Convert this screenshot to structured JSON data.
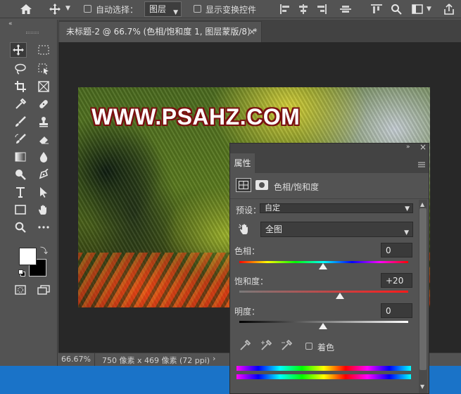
{
  "options_bar": {
    "auto_select_label": "自动选择：",
    "layer_select_value": "图层",
    "show_transform_label": "显示变换控件"
  },
  "document": {
    "tab_title": "未标题-2 @ 66.7% (色相/饱和度 1, 图层蒙版/8) *",
    "watermark": "WWW.PSAHZ.COM"
  },
  "status": {
    "zoom": "66.67%",
    "doc_info": "750 像素 x 469 像素 (72 ppi)"
  },
  "properties_panel": {
    "tab_label": "属性",
    "adjustment_title": "色相/饱和度",
    "preset_label": "预设：",
    "preset_value": "自定",
    "channel_value": "全图",
    "hue_label": "色相：",
    "hue_value": "0",
    "saturation_label": "饱和度：",
    "saturation_value": "+20",
    "lightness_label": "明度：",
    "lightness_value": "0",
    "colorize_label": "着色"
  },
  "colors": {
    "foreground": "#ffffff",
    "background": "#000000",
    "taskbar": "#1a73c8"
  }
}
